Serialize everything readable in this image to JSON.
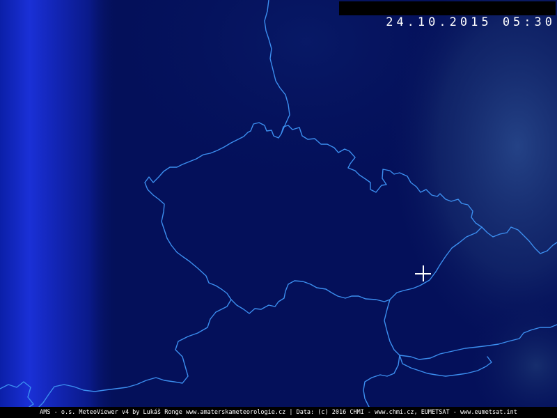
{
  "timestamp": {
    "date": "24.10.2015",
    "time": "05:30"
  },
  "footer": {
    "credits": "AMS - o.s. MeteoViewer v4 by Lukáš Ronge www.amaterskameteorologie.cz | Data: (c) 2016 CHMI - www.chmi.cz, EUMETSAT - www.eumetsat.int"
  },
  "map": {
    "colors": {
      "background": "#04105a",
      "border": "#3c8ff0",
      "cloud_band_left": "#1a2fd0",
      "cloud_east": "#25407a"
    },
    "cursor_icon": "crosshair-icon"
  }
}
